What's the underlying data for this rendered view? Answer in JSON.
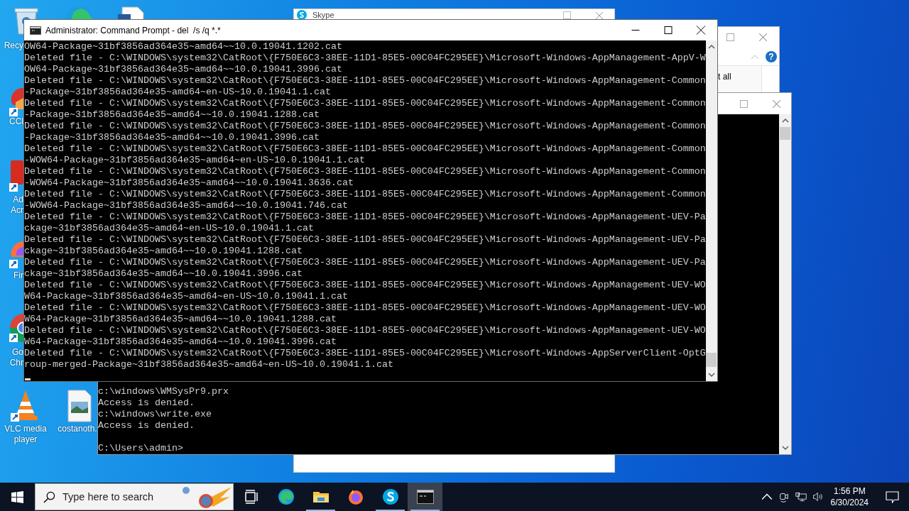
{
  "desktop_icons": [
    {
      "kind": "recycle-bin",
      "label": [
        "Recy"
      ]
    },
    {
      "kind": "edge"
    },
    {
      "kind": "document"
    },
    {
      "kind": "ccleaner",
      "label": [
        "CCl"
      ]
    },
    {
      "kind": "acrobat",
      "label": [
        "Ad",
        "Acr"
      ]
    },
    {
      "kind": "firefox",
      "label": [
        "Fir"
      ]
    },
    {
      "kind": "chrome",
      "label": [
        "Go",
        "Chr"
      ]
    },
    {
      "kind": "vlc",
      "label": [
        "VLC media",
        "player"
      ]
    },
    {
      "kind": "image-file",
      "label": [
        "costanoth."
      ]
    }
  ],
  "skype_window": {
    "title": "Skype"
  },
  "dialog_window": {
    "help": "?",
    "texts": [
      "t all"
    ]
  },
  "back_console": {
    "lines": [
      "c:\\windows\\WMSysPr9.prx",
      "Access is denied.",
      "c:\\windows\\write.exe",
      "Access is denied."
    ],
    "prompt": "C:\\Users\\admin>"
  },
  "front_console": {
    "title": "Administrator: Command Prompt - del  /s /q *.*",
    "lines": [
      "OW64-Package~31bf3856ad364e35~amd64~~10.0.19041.1202.cat",
      "Deleted file - C:\\WINDOWS\\system32\\CatRoot\\{F750E6C3-38EE-11D1-85E5-00C04FC295EE}\\Microsoft-Windows-AppManagement-AppV-W",
      "OW64-Package~31bf3856ad364e35~amd64~~10.0.19041.3996.cat",
      "Deleted file - C:\\WINDOWS\\system32\\CatRoot\\{F750E6C3-38EE-11D1-85E5-00C04FC295EE}\\Microsoft-Windows-AppManagement-Common",
      "-Package~31bf3856ad364e35~amd64~en-US~10.0.19041.1.cat",
      "Deleted file - C:\\WINDOWS\\system32\\CatRoot\\{F750E6C3-38EE-11D1-85E5-00C04FC295EE}\\Microsoft-Windows-AppManagement-Common",
      "-Package~31bf3856ad364e35~amd64~~10.0.19041.1288.cat",
      "Deleted file - C:\\WINDOWS\\system32\\CatRoot\\{F750E6C3-38EE-11D1-85E5-00C04FC295EE}\\Microsoft-Windows-AppManagement-Common",
      "-Package~31bf3856ad364e35~amd64~~10.0.19041.3996.cat",
      "Deleted file - C:\\WINDOWS\\system32\\CatRoot\\{F750E6C3-38EE-11D1-85E5-00C04FC295EE}\\Microsoft-Windows-AppManagement-Common",
      "-WOW64-Package~31bf3856ad364e35~amd64~en-US~10.0.19041.1.cat",
      "Deleted file - C:\\WINDOWS\\system32\\CatRoot\\{F750E6C3-38EE-11D1-85E5-00C04FC295EE}\\Microsoft-Windows-AppManagement-Common",
      "-WOW64-Package~31bf3856ad364e35~amd64~~10.0.19041.3636.cat",
      "Deleted file - C:\\WINDOWS\\system32\\CatRoot\\{F750E6C3-38EE-11D1-85E5-00C04FC295EE}\\Microsoft-Windows-AppManagement-Common",
      "-WOW64-Package~31bf3856ad364e35~amd64~~10.0.19041.746.cat",
      "Deleted file - C:\\WINDOWS\\system32\\CatRoot\\{F750E6C3-38EE-11D1-85E5-00C04FC295EE}\\Microsoft-Windows-AppManagement-UEV-Pa",
      "ckage~31bf3856ad364e35~amd64~en-US~10.0.19041.1.cat",
      "Deleted file - C:\\WINDOWS\\system32\\CatRoot\\{F750E6C3-38EE-11D1-85E5-00C04FC295EE}\\Microsoft-Windows-AppManagement-UEV-Pa",
      "ckage~31bf3856ad364e35~amd64~~10.0.19041.1288.cat",
      "Deleted file - C:\\WINDOWS\\system32\\CatRoot\\{F750E6C3-38EE-11D1-85E5-00C04FC295EE}\\Microsoft-Windows-AppManagement-UEV-Pa",
      "ckage~31bf3856ad364e35~amd64~~10.0.19041.3996.cat",
      "Deleted file - C:\\WINDOWS\\system32\\CatRoot\\{F750E6C3-38EE-11D1-85E5-00C04FC295EE}\\Microsoft-Windows-AppManagement-UEV-WO",
      "W64-Package~31bf3856ad364e35~amd64~en-US~10.0.19041.1.cat",
      "Deleted file - C:\\WINDOWS\\system32\\CatRoot\\{F750E6C3-38EE-11D1-85E5-00C04FC295EE}\\Microsoft-Windows-AppManagement-UEV-WO",
      "W64-Package~31bf3856ad364e35~amd64~~10.0.19041.1288.cat",
      "Deleted file - C:\\WINDOWS\\system32\\CatRoot\\{F750E6C3-38EE-11D1-85E5-00C04FC295EE}\\Microsoft-Windows-AppManagement-UEV-WO",
      "W64-Package~31bf3856ad364e35~amd64~~10.0.19041.3996.cat",
      "Deleted file - C:\\WINDOWS\\system32\\CatRoot\\{F750E6C3-38EE-11D1-85E5-00C04FC295EE}\\Microsoft-Windows-AppServerClient-OptG",
      "roup-merged-Package~31bf3856ad364e35~amd64~en-US~10.0.19041.1.cat"
    ]
  },
  "taskbar": {
    "search": {
      "placeholder": "Type here to search"
    },
    "apps": [
      {
        "kind": "task-view",
        "running": false,
        "active": false
      },
      {
        "kind": "edge",
        "running": false,
        "active": false
      },
      {
        "kind": "explorer",
        "running": true,
        "active": false
      },
      {
        "kind": "firefox",
        "running": false,
        "active": false
      },
      {
        "kind": "skype",
        "running": true,
        "active": false
      },
      {
        "kind": "cmd",
        "running": true,
        "active": true
      }
    ],
    "clock": {
      "time": "1:56 PM",
      "date": "6/30/2024"
    }
  }
}
